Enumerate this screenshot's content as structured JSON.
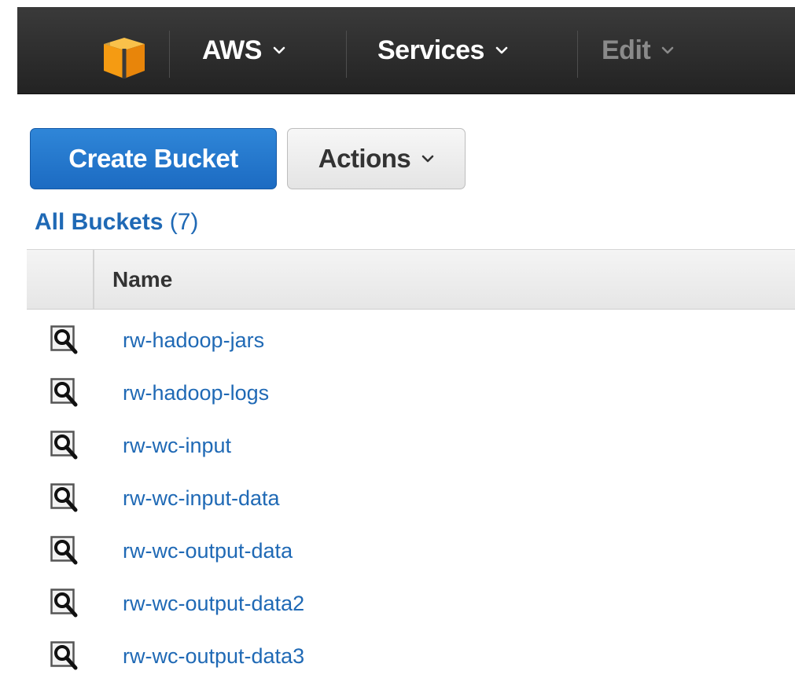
{
  "topbar": {
    "logo_icon": "aws-cube-icon",
    "menus": [
      {
        "label": "AWS",
        "icon": "chevron-down-icon",
        "enabled": true
      },
      {
        "label": "Services",
        "icon": "chevron-down-icon",
        "enabled": true
      },
      {
        "label": "Edit",
        "icon": "chevron-down-icon",
        "enabled": false
      }
    ]
  },
  "toolbar": {
    "create_label": "Create Bucket",
    "actions_label": "Actions"
  },
  "buckets_header": {
    "title": "All Buckets",
    "count": "(7)"
  },
  "table": {
    "column_name": "Name",
    "row_icon": "magnifier-icon",
    "rows": [
      "rw-hadoop-jars",
      "rw-hadoop-logs",
      "rw-wc-input",
      "rw-wc-input-data",
      "rw-wc-output-data",
      "rw-wc-output-data2",
      "rw-wc-output-data3"
    ]
  },
  "colors": {
    "topbar_bg": "#232323",
    "link": "#1f69b5",
    "primary_button": "#1f6fc5",
    "logo_orange": "#f7a21b"
  }
}
